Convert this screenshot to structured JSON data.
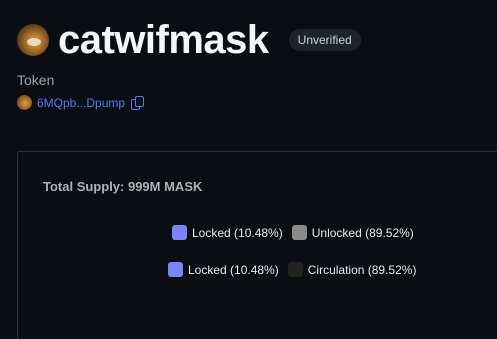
{
  "header": {
    "title": "catwifmask",
    "badge": "Unverified"
  },
  "token": {
    "label": "Token",
    "address": "6MQpb...Dpump"
  },
  "supply_card": {
    "total_supply": "Total Supply: 999M MASK",
    "legend_1": [
      {
        "label": "Locked (10.48%)",
        "color": "#7a86f7"
      },
      {
        "label": "Unlocked (89.52%)",
        "color": "#8a8a8a"
      }
    ],
    "legend_2": [
      {
        "label": "Locked (10.48%)",
        "color": "#7a86f7"
      },
      {
        "label": "Circulation (89.52%)",
        "color": "#222222"
      }
    ]
  },
  "icons": {
    "avatar": "cat-avatar-icon",
    "copy": "copy-icon"
  }
}
